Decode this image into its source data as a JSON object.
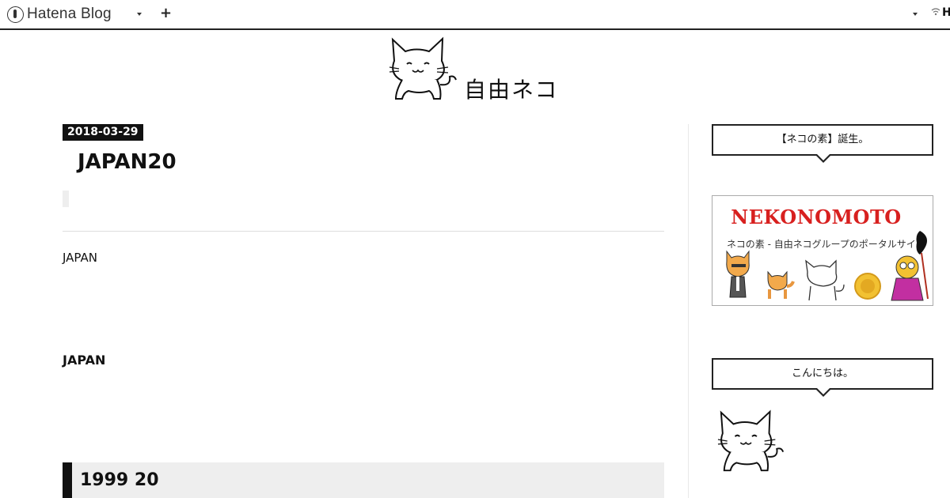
{
  "topbar": {
    "brand_name": "Hatena Blog",
    "plus_label": "+",
    "right_icon": "wifi-icon",
    "right_text": "H"
  },
  "blog": {
    "title": "自由ネコ",
    "logo_icon": "cat-mascot-icon"
  },
  "entry": {
    "date": "2018-03-29",
    "title": "JAPAN20",
    "paragraph_1": "JAPAN",
    "paragraph_2": "JAPAN",
    "heading": "1999 20"
  },
  "sidebar": {
    "module_1_title": "【ネコの素】誕生。",
    "banner": {
      "title": "NEKONOMOTO",
      "subtitle": "ネコの素 - 自由ネコグループのポータルサイト"
    },
    "module_2_title": "こんにちは。",
    "profile_icon": "cat-mascot-icon"
  },
  "colors": {
    "accent": "#111111",
    "banner_red": "#d8201f",
    "heading_bg": "#eeeeee"
  }
}
